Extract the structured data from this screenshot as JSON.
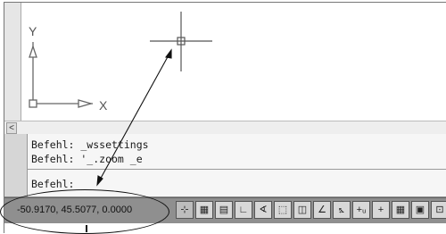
{
  "command_lines": [
    "Befehl: _wssettings",
    "Befehl: '_.zoom _e",
    "Befehl:"
  ],
  "status": {
    "coordinates": "-50.9170, 45.5077, 0.0000"
  },
  "ucs": {
    "x_label": "X",
    "y_label": "Y"
  },
  "toolbar_icons": [
    "snap-icon",
    "grid-icon",
    "grid-display-icon",
    "ortho-icon",
    "polar-icon",
    "osnap-icon",
    "otrack-icon",
    "ducs-icon",
    "dyn-icon",
    "lineweight-icon",
    "plus-icon",
    "model-icon",
    "qp-icon",
    "sc-icon"
  ],
  "toolbar_glyphs": [
    "⊹",
    "▦",
    "▤",
    "∟",
    "∢",
    "⬚",
    "◫",
    "∠",
    "⦩",
    "+ᵤ",
    "+",
    "▦",
    "▣",
    "⊡"
  ],
  "scroll_arrow": "<"
}
